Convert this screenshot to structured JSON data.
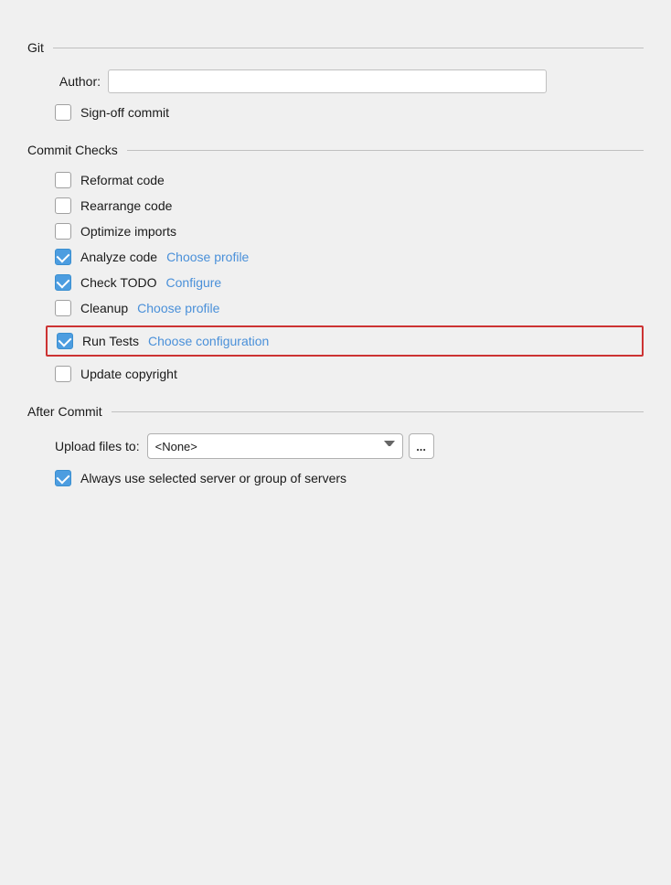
{
  "git_section": {
    "title": "Git",
    "author_label": "Author:",
    "author_placeholder": "",
    "sign_off_label": "Sign-off commit",
    "sign_off_checked": false
  },
  "commit_checks_section": {
    "title": "Commit Checks",
    "items": [
      {
        "id": "reformat",
        "label": "Reformat code",
        "checked": false,
        "link": null
      },
      {
        "id": "rearrange",
        "label": "Rearrange code",
        "checked": false,
        "link": null
      },
      {
        "id": "optimize",
        "label": "Optimize imports",
        "checked": false,
        "link": null
      },
      {
        "id": "analyze",
        "label": "Analyze code",
        "checked": true,
        "link": "Choose profile"
      },
      {
        "id": "check_todo",
        "label": "Check TODO",
        "checked": true,
        "link": "Configure"
      },
      {
        "id": "cleanup",
        "label": "Cleanup",
        "checked": false,
        "link": "Choose profile"
      },
      {
        "id": "run_tests",
        "label": "Run Tests",
        "checked": true,
        "link": "Choose configuration",
        "highlighted": true
      },
      {
        "id": "update_copyright",
        "label": "Update copyright",
        "checked": false,
        "link": null
      }
    ]
  },
  "after_commit_section": {
    "title": "After Commit",
    "upload_label": "Upload files to:",
    "upload_value": "<None>",
    "ellipsis_label": "...",
    "always_use_label": "Always use selected server or group of servers",
    "always_use_checked": true
  }
}
